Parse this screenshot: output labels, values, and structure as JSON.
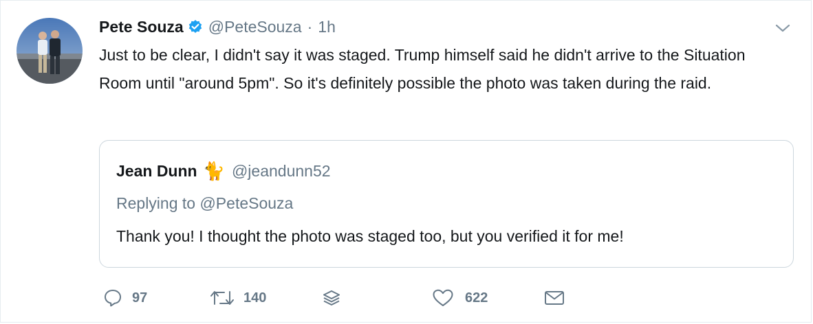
{
  "tweet": {
    "author_name": "Pete Souza",
    "handle": "@PeteSouza",
    "separator": "·",
    "time": "1h",
    "verified": true,
    "avatar_icon": "profile-photo",
    "text": "Just to be clear, I didn't say it was staged. Trump himself said he didn't arrive to the Situation Room until \"around 5pm\". So it's definitely possible the photo was taken during the raid."
  },
  "quoted_tweet": {
    "author_name": "Jean Dunn",
    "emoji": "🐈",
    "handle": "@jeandunn52",
    "replying_to": "Replying to @PeteSouza",
    "text": "Thank you! I thought the photo was staged too, but you verified it for me!"
  },
  "actions": {
    "reply_count": "97",
    "retweet_count": "140",
    "like_count": "622",
    "icons": [
      "reply-icon",
      "retweet-icon",
      "stack-icon",
      "heart-icon",
      "envelope-icon"
    ]
  },
  "colors": {
    "text_primary": "#14171a",
    "text_secondary": "#657786",
    "verified_blue": "#1da1f2",
    "border": "#ccd6dd"
  }
}
